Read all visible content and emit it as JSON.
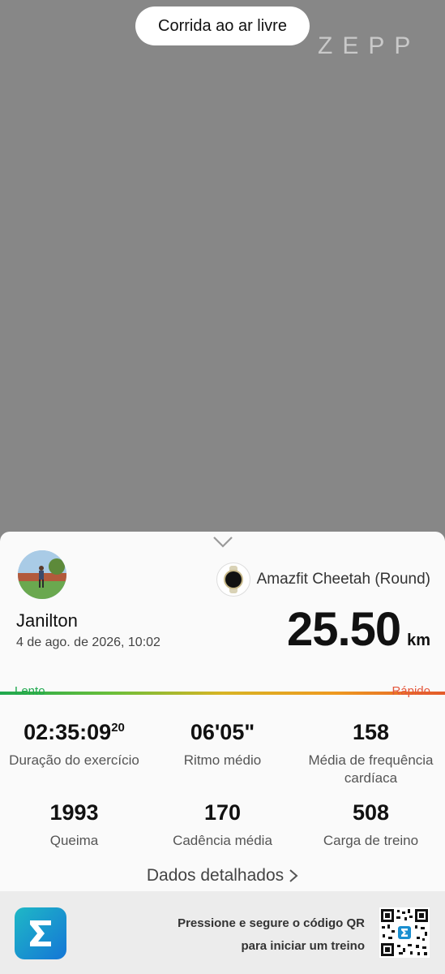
{
  "header": {
    "activity_type": "Corrida ao ar livre",
    "brand": "ZEPP"
  },
  "user": {
    "name": "Janilton",
    "date": "4 de ago. de 2026, 10:02"
  },
  "device": {
    "name": "Amazfit Cheetah (Round)"
  },
  "summary": {
    "distance": "25.50",
    "unit": "km"
  },
  "pace_scale": {
    "slow_label": "Lento",
    "fast_label": "Rápido"
  },
  "stats": [
    {
      "value": "02:35:09",
      "sup": "20",
      "label": "Duração do exercício"
    },
    {
      "value": "06'05\"",
      "label": "Ritmo médio"
    },
    {
      "value": "158",
      "label": "Média de frequência cardíaca"
    },
    {
      "value": "1993",
      "label": "Queima"
    },
    {
      "value": "170",
      "label": "Cadência média"
    },
    {
      "value": "508",
      "label": "Carga de treino"
    }
  ],
  "details_link": "Dados detalhados",
  "footer": {
    "qr_line1": "Pressione e segure o código QR",
    "qr_line2": "para iniciar um treino"
  },
  "colors": {
    "pace_slow": "#1fa84e",
    "pace_fast": "#e4553a",
    "app_icon": "#1a8fd0"
  }
}
